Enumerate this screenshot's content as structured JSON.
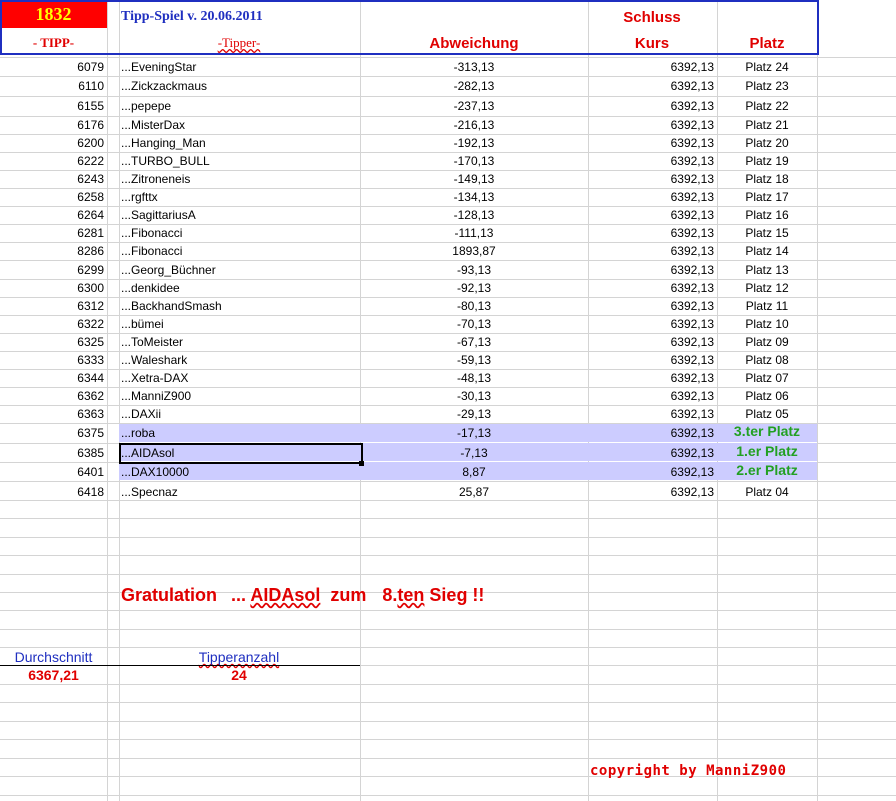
{
  "header": {
    "tipp_number": "1832",
    "title": "Tipp-Spiel v. 20.06.2011",
    "schluss": "Schluss",
    "col_tipp": "- TIPP-",
    "col_tipper": "-Tipper-",
    "col_abweichung": "Abweichung",
    "col_kurs": "Kurs",
    "col_platz": "Platz"
  },
  "rows": [
    {
      "tipp": "6079",
      "name": "...EveningStar",
      "abw": "-313,13",
      "kurs": "6392,13",
      "platz": "Platz 24"
    },
    {
      "tipp": "6110",
      "name": "...Zickzackmaus",
      "abw": "-282,13",
      "kurs": "6392,13",
      "platz": "Platz 23"
    },
    {
      "tipp": "6155",
      "name": "...pepepe",
      "abw": "-237,13",
      "kurs": "6392,13",
      "platz": "Platz 22"
    },
    {
      "tipp": "6176",
      "name": "...MisterDax",
      "abw": "-216,13",
      "kurs": "6392,13",
      "platz": "Platz 21"
    },
    {
      "tipp": "6200",
      "name": "...Hanging_Man",
      "abw": "-192,13",
      "kurs": "6392,13",
      "platz": "Platz 20"
    },
    {
      "tipp": "6222",
      "name": "...TURBO_BULL",
      "abw": "-170,13",
      "kurs": "6392,13",
      "platz": "Platz 19"
    },
    {
      "tipp": "6243",
      "name": "...Zitroneneis",
      "abw": "-149,13",
      "kurs": "6392,13",
      "platz": "Platz 18"
    },
    {
      "tipp": "6258",
      "name": "...rgfttx",
      "abw": "-134,13",
      "kurs": "6392,13",
      "platz": "Platz 17"
    },
    {
      "tipp": "6264",
      "name": "...SagittariusA",
      "abw": "-128,13",
      "kurs": "6392,13",
      "platz": "Platz 16"
    },
    {
      "tipp": "6281",
      "name": "...Fibonacci",
      "abw": "-111,13",
      "kurs": "6392,13",
      "platz": "Platz 15"
    },
    {
      "tipp": "8286",
      "name": "...Fibonacci",
      "abw": "1893,87",
      "kurs": "6392,13",
      "platz": "Platz 14"
    },
    {
      "tipp": "6299",
      "name": "...Georg_Büchner",
      "abw": "-93,13",
      "kurs": "6392,13",
      "platz": "Platz 13"
    },
    {
      "tipp": "6300",
      "name": "...denkidee",
      "abw": "-92,13",
      "kurs": "6392,13",
      "platz": "Platz 12"
    },
    {
      "tipp": "6312",
      "name": "...BackhandSmash",
      "abw": "-80,13",
      "kurs": "6392,13",
      "platz": "Platz 11"
    },
    {
      "tipp": "6322",
      "name": "...bümei",
      "abw": "-70,13",
      "kurs": "6392,13",
      "platz": "Platz 10"
    },
    {
      "tipp": "6325",
      "name": "...ToMeister",
      "abw": "-67,13",
      "kurs": "6392,13",
      "platz": "Platz 09"
    },
    {
      "tipp": "6333",
      "name": "...Waleshark",
      "abw": "-59,13",
      "kurs": "6392,13",
      "platz": "Platz 08"
    },
    {
      "tipp": "6344",
      "name": "...Xetra-DAX",
      "abw": "-48,13",
      "kurs": "6392,13",
      "platz": "Platz 07"
    },
    {
      "tipp": "6362",
      "name": "...ManniZ900",
      "abw": "-30,13",
      "kurs": "6392,13",
      "platz": "Platz 06"
    },
    {
      "tipp": "6363",
      "name": "...DAXii",
      "abw": "-29,13",
      "kurs": "6392,13",
      "platz": "Platz 05"
    },
    {
      "tipp": "6375",
      "name": "...roba",
      "abw": "-17,13",
      "kurs": "6392,13",
      "platz": "3.ter Platz"
    },
    {
      "tipp": "6385",
      "name": "...AIDAsol",
      "abw": "-7,13",
      "kurs": "6392,13",
      "platz": "1.er Platz"
    },
    {
      "tipp": "6401",
      "name": "...DAX10000",
      "abw": "8,87",
      "kurs": "6392,13",
      "platz": "2.er Platz"
    },
    {
      "tipp": "6418",
      "name": "...Specnaz",
      "abw": "25,87",
      "kurs": "6392,13",
      "platz": "Platz 04"
    }
  ],
  "gratulation": {
    "word1": "Gratulation",
    "dots": "...",
    "winner": "AIDAsol",
    "zum": "zum",
    "num": "8.",
    "ten": "ten",
    "sieg": "Sieg !!"
  },
  "stats": {
    "durchschnitt_label": "Durchschnitt",
    "durchschnitt_value": "6367,21",
    "tipperanzahl_label": "Tipperanzahl",
    "tipperanzahl_value": "24"
  },
  "copyright": "copyright by ManniZ900",
  "colors": {
    "header_red": "#ff0000",
    "title_blue": "#1f2fc0",
    "text_red": "#e00000",
    "podium_green": "#22a022",
    "highlight": "#ccccff"
  }
}
